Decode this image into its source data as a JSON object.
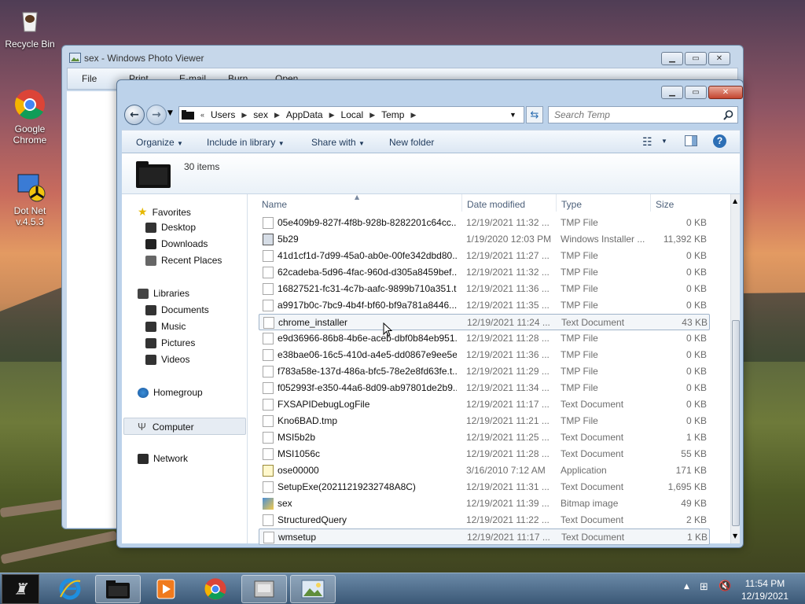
{
  "desktop": {
    "icons": [
      {
        "label": "Recycle Bin"
      },
      {
        "label": "Google Chrome"
      },
      {
        "label": "Dot Net v.4.5.3"
      }
    ]
  },
  "photo_viewer": {
    "title": "sex - Windows Photo Viewer",
    "menu": [
      "File",
      "Print",
      "E-mail",
      "Burn",
      "Open"
    ]
  },
  "explorer": {
    "breadcrumb": [
      "Users",
      "sex",
      "AppData",
      "Local",
      "Temp"
    ],
    "search_placeholder": "Search Temp",
    "toolbar": {
      "organize": "Organize",
      "include_in_library": "Include in library",
      "share_with": "Share with",
      "new_folder": "New folder"
    },
    "item_count": "30 items",
    "nav": {
      "favorites": "Favorites",
      "desktop": "Desktop",
      "downloads": "Downloads",
      "recent_places": "Recent Places",
      "libraries": "Libraries",
      "documents": "Documents",
      "music": "Music",
      "pictures": "Pictures",
      "videos": "Videos",
      "homegroup": "Homegroup",
      "computer": "Computer",
      "network": "Network"
    },
    "columns": {
      "name": "Name",
      "date": "Date modified",
      "type": "Type",
      "size": "Size"
    },
    "files": [
      {
        "name": "05e409b9-827f-4f8b-928b-8282201c64cc....",
        "date": "12/19/2021 11:32 ...",
        "type": "TMP File",
        "size": "0 KB"
      },
      {
        "name": "5b29",
        "date": "1/19/2020 12:03 PM",
        "type": "Windows Installer ...",
        "size": "11,392 KB"
      },
      {
        "name": "41d1cf1d-7d99-45a0-ab0e-00fe342dbd80...",
        "date": "12/19/2021 11:27 ...",
        "type": "TMP File",
        "size": "0 KB"
      },
      {
        "name": "62cadeba-5d96-4fac-960d-d305a8459bef....",
        "date": "12/19/2021 11:32 ...",
        "type": "TMP File",
        "size": "0 KB"
      },
      {
        "name": "16827521-fc31-4c7b-aafc-9899b710a351.t...",
        "date": "12/19/2021 11:36 ...",
        "type": "TMP File",
        "size": "0 KB"
      },
      {
        "name": "a9917b0c-7bc9-4b4f-bf60-bf9a781a8446....",
        "date": "12/19/2021 11:35 ...",
        "type": "TMP File",
        "size": "0 KB"
      },
      {
        "name": "chrome_installer",
        "date": "12/19/2021 11:24 ...",
        "type": "Text Document",
        "size": "43 KB"
      },
      {
        "name": "e9d36966-86b8-4b6e-aceb-dbf0b84eb951....",
        "date": "12/19/2021 11:28 ...",
        "type": "TMP File",
        "size": "0 KB"
      },
      {
        "name": "e38bae06-16c5-410d-a4e5-dd0867e9ee5e....",
        "date": "12/19/2021 11:36 ...",
        "type": "TMP File",
        "size": "0 KB"
      },
      {
        "name": "f783a58e-137d-486a-bfc5-78e2e8fd63fe.t...",
        "date": "12/19/2021 11:29 ...",
        "type": "TMP File",
        "size": "0 KB"
      },
      {
        "name": "f052993f-e350-44a6-8d09-ab97801de2b9....",
        "date": "12/19/2021 11:34 ...",
        "type": "TMP File",
        "size": "0 KB"
      },
      {
        "name": "FXSAPIDebugLogFile",
        "date": "12/19/2021 11:17 ...",
        "type": "Text Document",
        "size": "0 KB"
      },
      {
        "name": "Kno6BAD.tmp",
        "date": "12/19/2021 11:21 ...",
        "type": "TMP File",
        "size": "0 KB"
      },
      {
        "name": "MSI5b2b",
        "date": "12/19/2021 11:25 ...",
        "type": "Text Document",
        "size": "1 KB"
      },
      {
        "name": "MSI1056c",
        "date": "12/19/2021 11:28 ...",
        "type": "Text Document",
        "size": "55 KB"
      },
      {
        "name": "ose00000",
        "date": "3/16/2010 7:12 AM",
        "type": "Application",
        "size": "171 KB"
      },
      {
        "name": "SetupExe(20211219232748A8C)",
        "date": "12/19/2021 11:31 ...",
        "type": "Text Document",
        "size": "1,695 KB"
      },
      {
        "name": "sex",
        "date": "12/19/2021 11:39 ...",
        "type": "Bitmap image",
        "size": "49 KB"
      },
      {
        "name": "StructuredQuery",
        "date": "12/19/2021 11:22 ...",
        "type": "Text Document",
        "size": "2 KB"
      },
      {
        "name": "wmsetup",
        "date": "12/19/2021 11:17 ...",
        "type": "Text Document",
        "size": "1 KB"
      }
    ]
  },
  "taskbar": {
    "time": "11:54 PM",
    "date": "12/19/2021"
  },
  "colors": {
    "selection_border": "#9fb3c9",
    "window_frame": "#bcd2ea",
    "taskbar": "#3b5876"
  }
}
